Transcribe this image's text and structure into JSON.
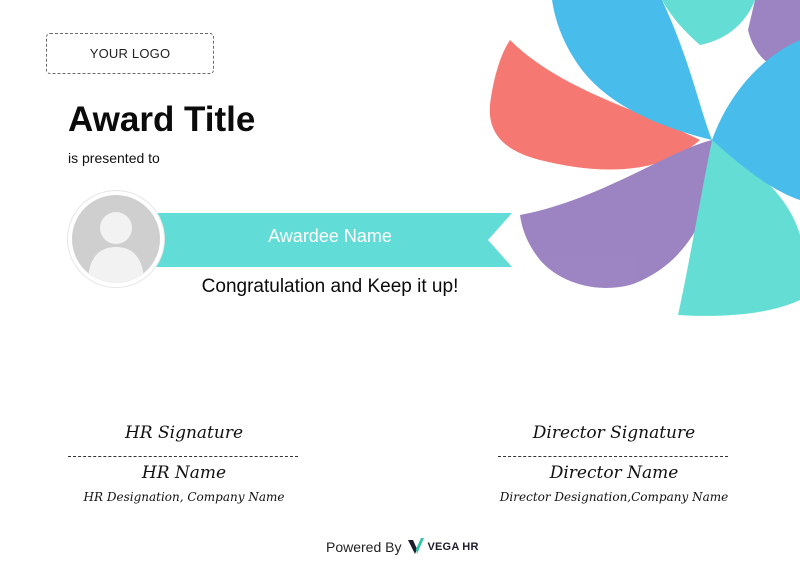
{
  "logo_placeholder": "YOUR LOGO",
  "award": {
    "title": "Award Title",
    "presented_text": "is presented to",
    "awardee_name": "Awardee Name",
    "message": "Congratulation and Keep it up!"
  },
  "signatures": {
    "left": {
      "signature_label": "HR Signature",
      "name": "HR Name",
      "designation": "HR Designation, Company Name"
    },
    "right": {
      "signature_label": "Director Signature",
      "name": "Director Name",
      "designation": "Director Designation,Company Name"
    }
  },
  "footer": {
    "powered_by": "Powered By",
    "brand": "VEGA HR"
  },
  "colors": {
    "ribbon": "#62dcd6",
    "petal_red": "#f4675f",
    "petal_blue": "#2fb3e8",
    "petal_purple": "#8f73b9",
    "petal_teal": "#4fd9cf",
    "avatar_bg": "#cfcfcf"
  },
  "icons": {
    "avatar": "user-avatar-icon",
    "brand_logo": "vega-hr-logo-icon"
  }
}
